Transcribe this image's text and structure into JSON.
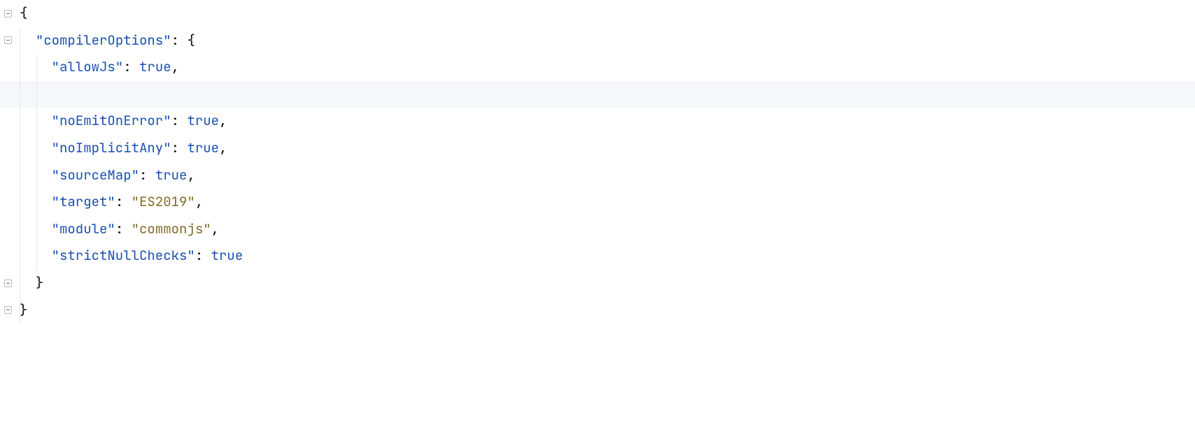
{
  "code": {
    "lines": [
      {
        "indent": 0,
        "tokens": [
          {
            "t": "{",
            "cls": "punct"
          }
        ],
        "fold": "start",
        "guide": false
      },
      {
        "indent": 1,
        "tokens": [
          {
            "t": "\"compilerOptions\"",
            "cls": "key"
          },
          {
            "t": ": ",
            "cls": "punct"
          },
          {
            "t": "{",
            "cls": "punct"
          }
        ],
        "fold": "start",
        "guide": false
      },
      {
        "indent": 2,
        "tokens": [
          {
            "t": "\"allowJs\"",
            "cls": "key"
          },
          {
            "t": ": ",
            "cls": "punct"
          },
          {
            "t": "true",
            "cls": "bool"
          },
          {
            "t": ",",
            "cls": "comma"
          }
        ],
        "fold": null,
        "guide": true
      },
      {
        "indent": 2,
        "tokens": [],
        "fold": null,
        "guide": true,
        "highlighted": true
      },
      {
        "indent": 2,
        "tokens": [
          {
            "t": "\"noEmitOnError\"",
            "cls": "key"
          },
          {
            "t": ": ",
            "cls": "punct"
          },
          {
            "t": "true",
            "cls": "bool"
          },
          {
            "t": ",",
            "cls": "comma"
          }
        ],
        "fold": null,
        "guide": true
      },
      {
        "indent": 2,
        "tokens": [
          {
            "t": "\"noImplicitAny\"",
            "cls": "key"
          },
          {
            "t": ": ",
            "cls": "punct"
          },
          {
            "t": "true",
            "cls": "bool"
          },
          {
            "t": ",",
            "cls": "comma"
          }
        ],
        "fold": null,
        "guide": true
      },
      {
        "indent": 2,
        "tokens": [
          {
            "t": "\"sourceMap\"",
            "cls": "key"
          },
          {
            "t": ": ",
            "cls": "punct"
          },
          {
            "t": "true",
            "cls": "bool"
          },
          {
            "t": ",",
            "cls": "comma"
          }
        ],
        "fold": null,
        "guide": true
      },
      {
        "indent": 2,
        "tokens": [
          {
            "t": "\"target\"",
            "cls": "key"
          },
          {
            "t": ": ",
            "cls": "punct"
          },
          {
            "t": "\"ES2019\"",
            "cls": "str"
          },
          {
            "t": ",",
            "cls": "comma"
          }
        ],
        "fold": null,
        "guide": true
      },
      {
        "indent": 2,
        "tokens": [
          {
            "t": "\"module\"",
            "cls": "key"
          },
          {
            "t": ": ",
            "cls": "punct"
          },
          {
            "t": "\"commonjs\"",
            "cls": "str"
          },
          {
            "t": ",",
            "cls": "comma"
          }
        ],
        "fold": null,
        "guide": true
      },
      {
        "indent": 2,
        "tokens": [
          {
            "t": "\"strictNullChecks\"",
            "cls": "key"
          },
          {
            "t": ": ",
            "cls": "punct"
          },
          {
            "t": "true",
            "cls": "bool"
          }
        ],
        "fold": null,
        "guide": true
      },
      {
        "indent": 1,
        "tokens": [
          {
            "t": "}",
            "cls": "punct"
          }
        ],
        "fold": "end",
        "guide": false
      },
      {
        "indent": 0,
        "tokens": [
          {
            "t": "}",
            "cls": "punct"
          }
        ],
        "fold": "end",
        "guide": false
      },
      {
        "indent": 0,
        "tokens": [],
        "fold": null,
        "guide": false
      }
    ],
    "indentUnit": "  ",
    "lineHeight": 38.6
  }
}
